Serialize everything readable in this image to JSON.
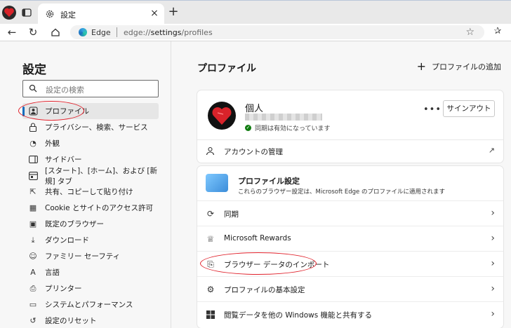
{
  "tab": {
    "title": "設定",
    "close": "×"
  },
  "newtab": "+",
  "address": {
    "site": "Edge",
    "url_prefix": "edge://",
    "url_path": "settings",
    "url_suffix": "/profiles"
  },
  "sidebar": {
    "title": "設定",
    "search_placeholder": "設定の検索",
    "items": [
      {
        "label": "プロファイル",
        "icon": "profile-icon"
      },
      {
        "label": "プライバシー、検索、サービス",
        "icon": "lock-icon"
      },
      {
        "label": "外観",
        "icon": "appearance-icon"
      },
      {
        "label": "サイドバー",
        "icon": "sidebar-icon"
      },
      {
        "label": "[スタート]、[ホーム]、および [新規] タブ",
        "icon": "home-tab-icon"
      },
      {
        "label": "共有、コピーして貼り付け",
        "icon": "share-icon"
      },
      {
        "label": "Cookie とサイトのアクセス許可",
        "icon": "cookie-icon"
      },
      {
        "label": "既定のブラウザー",
        "icon": "browser-icon"
      },
      {
        "label": "ダウンロード",
        "icon": "download-icon"
      },
      {
        "label": "ファミリー セーフティ",
        "icon": "family-icon"
      },
      {
        "label": "言語",
        "icon": "language-icon"
      },
      {
        "label": "プリンター",
        "icon": "printer-icon"
      },
      {
        "label": "システムとパフォーマンス",
        "icon": "system-icon"
      },
      {
        "label": "設定のリセット",
        "icon": "reset-icon"
      }
    ]
  },
  "main": {
    "title": "プロファイル",
    "add_profile": "プロファイルの追加",
    "profile": {
      "name": "個人",
      "sync_status": "同期は有効になっています",
      "more": "•••",
      "signout": "サインアウト"
    },
    "account_manage": "アカウントの管理",
    "profile_settings": {
      "title": "プロファイル設定",
      "description": "これらのブラウザー設定は、Microsoft Edge のプロファイルに適用されます"
    },
    "rows": [
      {
        "label": "同期",
        "icon": "sync-icon"
      },
      {
        "label": "Microsoft Rewards",
        "icon": "rewards-icon"
      },
      {
        "label": "ブラウザー データのインポート",
        "icon": "import-icon"
      },
      {
        "label": "プロファイルの基本設定",
        "icon": "preferences-icon"
      },
      {
        "label": "閲覧データを他の Windows 機能と共有する",
        "icon": "windows-icon"
      }
    ]
  },
  "colors": {
    "accent": "#0f6cbd",
    "annotation": "#e0202a",
    "ok": "#107c10"
  }
}
